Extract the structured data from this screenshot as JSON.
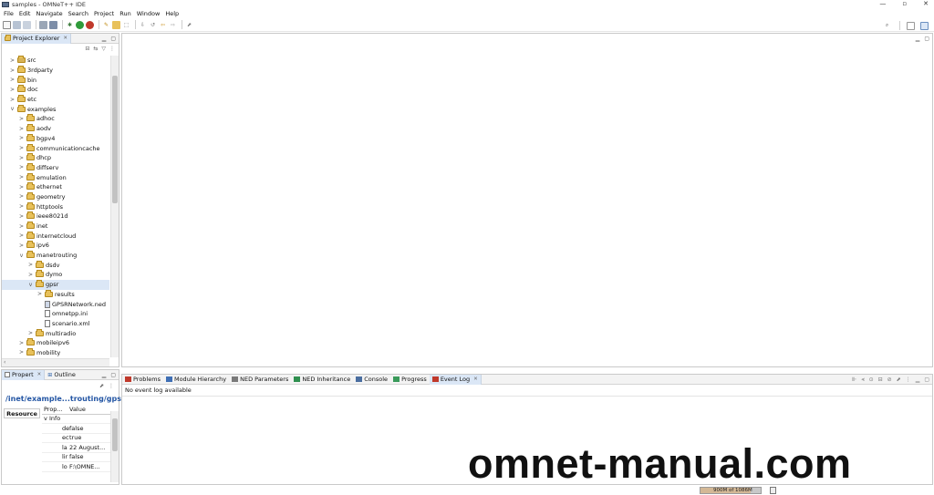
{
  "window": {
    "title": "samples - OMNeT++ IDE",
    "controls": [
      "—",
      "▫",
      "✕"
    ]
  },
  "menu": [
    "File",
    "Edit",
    "Navigate",
    "Search",
    "Project",
    "Run",
    "Window",
    "Help"
  ],
  "project_explorer": {
    "tab_label": "Project Explorer",
    "items": [
      {
        "label": "src",
        "indent": 1,
        "chev": ">",
        "icon": "src-folder-icon"
      },
      {
        "label": "3rdparty",
        "indent": 1,
        "chev": ">",
        "icon": "folder-icon"
      },
      {
        "label": "bin",
        "indent": 1,
        "chev": ">",
        "icon": "folder-icon"
      },
      {
        "label": "doc",
        "indent": 1,
        "chev": ">",
        "icon": "folder-icon"
      },
      {
        "label": "etc",
        "indent": 1,
        "chev": ">",
        "icon": "folder-icon"
      },
      {
        "label": "examples",
        "indent": 1,
        "chev": "v",
        "icon": "folder-icon"
      },
      {
        "label": "adhoc",
        "indent": 2,
        "chev": ">",
        "icon": "folder-icon"
      },
      {
        "label": "aodv",
        "indent": 2,
        "chev": ">",
        "icon": "folder-icon"
      },
      {
        "label": "bgpv4",
        "indent": 2,
        "chev": ">",
        "icon": "folder-icon"
      },
      {
        "label": "communicationcache",
        "indent": 2,
        "chev": ">",
        "icon": "folder-icon"
      },
      {
        "label": "dhcp",
        "indent": 2,
        "chev": ">",
        "icon": "folder-icon"
      },
      {
        "label": "diffserv",
        "indent": 2,
        "chev": ">",
        "icon": "folder-icon"
      },
      {
        "label": "emulation",
        "indent": 2,
        "chev": ">",
        "icon": "folder-icon"
      },
      {
        "label": "ethernet",
        "indent": 2,
        "chev": ">",
        "icon": "folder-icon"
      },
      {
        "label": "geometry",
        "indent": 2,
        "chev": ">",
        "icon": "folder-icon"
      },
      {
        "label": "httptools",
        "indent": 2,
        "chev": ">",
        "icon": "folder-icon"
      },
      {
        "label": "ieee8021d",
        "indent": 2,
        "chev": ">",
        "icon": "folder-icon"
      },
      {
        "label": "inet",
        "indent": 2,
        "chev": ">",
        "icon": "folder-icon"
      },
      {
        "label": "internetcloud",
        "indent": 2,
        "chev": ">",
        "icon": "folder-icon"
      },
      {
        "label": "ipv6",
        "indent": 2,
        "chev": ">",
        "icon": "folder-icon"
      },
      {
        "label": "manetrouting",
        "indent": 2,
        "chev": "v",
        "icon": "folder-icon"
      },
      {
        "label": "dsdv",
        "indent": 3,
        "chev": ">",
        "icon": "folder-icon"
      },
      {
        "label": "dymo",
        "indent": 3,
        "chev": ">",
        "icon": "folder-icon"
      },
      {
        "label": "gpsr",
        "indent": 3,
        "chev": "v",
        "icon": "folder-icon",
        "selected": true
      },
      {
        "label": "results",
        "indent": 4,
        "chev": ">",
        "icon": "folder-icon"
      },
      {
        "label": "GPSRNetwork.ned",
        "indent": 4,
        "chev": "",
        "icon": "ned-file-icon"
      },
      {
        "label": "omnetpp.ini",
        "indent": 4,
        "chev": "",
        "icon": "ini-file-icon"
      },
      {
        "label": "scenario.xml",
        "indent": 4,
        "chev": "",
        "icon": "xml-file-icon"
      },
      {
        "label": "multiradio",
        "indent": 3,
        "chev": ">",
        "icon": "folder-icon"
      },
      {
        "label": "mobileipv6",
        "indent": 2,
        "chev": ">",
        "icon": "folder-icon"
      },
      {
        "label": "mobility",
        "indent": 2,
        "chev": ">",
        "icon": "folder-icon"
      }
    ]
  },
  "properties": {
    "tab_label": "Propert",
    "outline_label": "Outline",
    "path": "/inet/example...trouting/gpsr",
    "resource_tab": "Resource",
    "col_property": "Prop...",
    "col_value": "Value",
    "group": "Info",
    "rows": [
      {
        "name": "de",
        "value": "false"
      },
      {
        "name": "ec",
        "value": "true"
      },
      {
        "name": "la",
        "value": "22 August..."
      },
      {
        "name": "lir",
        "value": "false"
      },
      {
        "name": "lo",
        "value": "F:\\OMNE..."
      }
    ]
  },
  "bottom_tabs": [
    {
      "label": "Problems",
      "icon": "problems-icon"
    },
    {
      "label": "Module Hierarchy",
      "icon": "module-hierarchy-icon"
    },
    {
      "label": "NED Parameters",
      "icon": "ned-parameters-icon"
    },
    {
      "label": "NED Inheritance",
      "icon": "ned-inheritance-icon"
    },
    {
      "label": "Console",
      "icon": "console-icon"
    },
    {
      "label": "Progress",
      "icon": "progress-icon"
    },
    {
      "label": "Event Log",
      "icon": "event-log-icon",
      "active": true
    }
  ],
  "event_log": {
    "message": "No event log available"
  },
  "status": {
    "heap": "900M of 1086M",
    "heap_fraction": 0.83
  },
  "watermark": "omnet-manual.com"
}
